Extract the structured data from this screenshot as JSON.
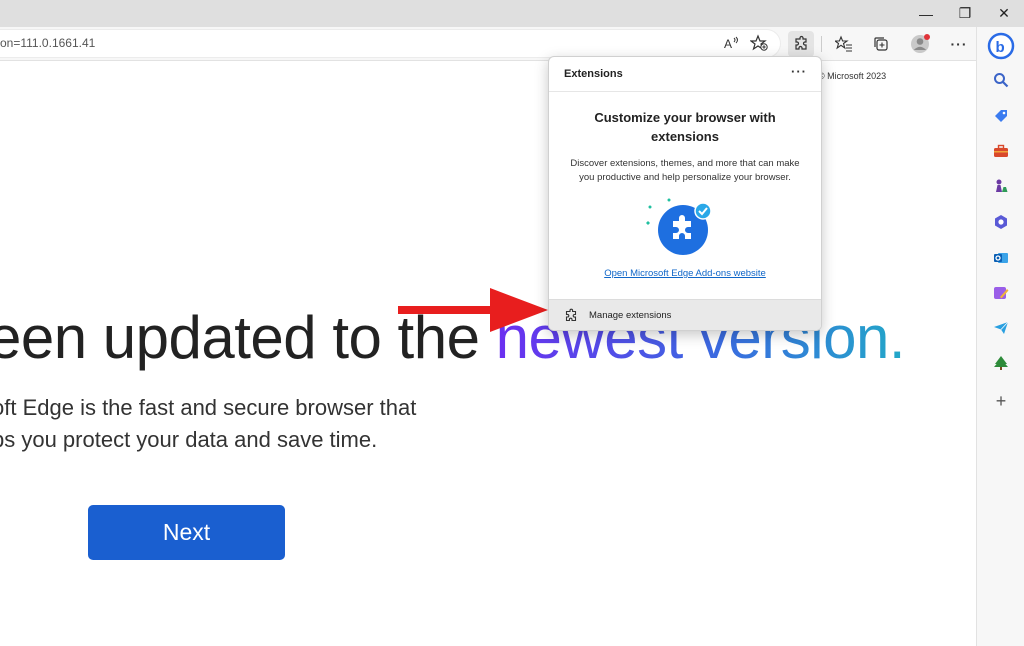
{
  "window": {
    "minimize_glyph": "—",
    "restore_glyph": "❐",
    "close_glyph": "✕"
  },
  "address_bar": {
    "url": "on=111.0.1661.41"
  },
  "toolbar_icons": [
    "read-aloud-icon",
    "add-favorite-icon",
    "extensions-icon",
    "favorites-icon",
    "collections-icon",
    "profile-icon",
    "more-icon"
  ],
  "sidebar_icons": [
    "bing-icon",
    "search-icon",
    "shopping-tag-icon",
    "tools-briefcase-icon",
    "games-chess-icon",
    "microsoft-365-icon",
    "outlook-icon",
    "drop-icon",
    "telegram-icon",
    "tree-icon",
    "add-icon"
  ],
  "page": {
    "copyright": "© Microsoft 2023",
    "headline_plain": "een updated to the ",
    "headline_accent": "newest version.",
    "subtitle_line1": "oft Edge is the fast and secure browser that",
    "subtitle_line2": "ps you protect your data and save time.",
    "next_label": "Next"
  },
  "extensions_popup": {
    "title": "Extensions",
    "more_label": "···",
    "heading_line1": "Customize your browser with",
    "heading_line2": "extensions",
    "description_line1": "Discover extensions, themes, and more that can make",
    "description_line2": "you productive and help personalize your browser.",
    "addons_link": "Open Microsoft Edge Add-ons website",
    "manage_label": "Manage extensions"
  },
  "colors": {
    "accent_blue": "#1a5fd0",
    "annotation_arrow": "#e81e1e",
    "link": "#0f66c8"
  }
}
